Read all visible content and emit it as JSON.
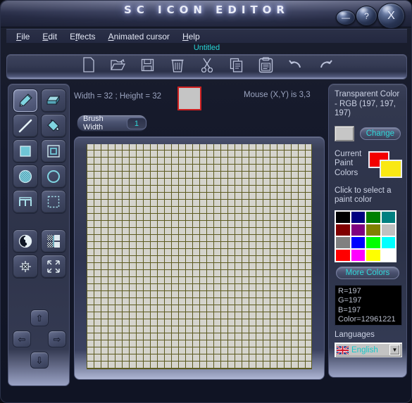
{
  "window": {
    "title": "SC ICON EDITOR",
    "controls": {
      "minimize": "—",
      "help": "?",
      "close": "X"
    }
  },
  "menubar": {
    "items": [
      {
        "label": "File",
        "accel": "F"
      },
      {
        "label": "Edit",
        "accel": "E"
      },
      {
        "label": "Effects",
        "accel": "f"
      },
      {
        "label": "Animated cursor",
        "accel": "A"
      },
      {
        "label": "Help",
        "accel": "H"
      }
    ]
  },
  "document": {
    "name": "Untitled"
  },
  "toolbar": {
    "buttons": [
      {
        "name": "new-file",
        "tooltip": "New"
      },
      {
        "name": "open-file",
        "tooltip": "Open"
      },
      {
        "name": "save-file",
        "tooltip": "Save"
      },
      {
        "name": "delete",
        "tooltip": "Delete"
      },
      {
        "name": "cut",
        "tooltip": "Cut"
      },
      {
        "name": "copy",
        "tooltip": "Copy"
      },
      {
        "name": "paste",
        "tooltip": "Paste"
      },
      {
        "name": "undo",
        "tooltip": "Undo"
      },
      {
        "name": "redo",
        "tooltip": "Redo"
      }
    ]
  },
  "tools": {
    "items": [
      {
        "name": "pencil",
        "selected": true
      },
      {
        "name": "eraser",
        "selected": false
      },
      {
        "name": "line",
        "selected": false
      },
      {
        "name": "paint-bucket",
        "selected": false
      },
      {
        "name": "filled-rectangle",
        "selected": false
      },
      {
        "name": "rectangle-outline",
        "selected": false
      },
      {
        "name": "filled-circle",
        "selected": false
      },
      {
        "name": "circle-outline",
        "selected": false
      },
      {
        "name": "text-tool",
        "selected": false
      },
      {
        "name": "select-region",
        "selected": false
      },
      {
        "name": "airbrush",
        "selected": false
      },
      {
        "name": "eyedropper",
        "selected": false
      },
      {
        "name": "invert-colors",
        "selected": false
      },
      {
        "name": "transparency",
        "selected": false
      },
      {
        "name": "shrink",
        "selected": false
      },
      {
        "name": "stretch",
        "selected": false
      }
    ],
    "arrows": {
      "up": "⇧",
      "left": "⇦",
      "right": "⇨",
      "down": "⇩"
    }
  },
  "canvas": {
    "dimensions_text": "Width = 32 ; Height = 32",
    "mouse_text": "Mouse (X,Y) is 3,3",
    "brush_width_label": "Brush Width",
    "brush_width_value": "1",
    "preview_color": "#c5c5c5",
    "preview_border": "#ce2020",
    "grid_cols": 32,
    "grid_rows": 32,
    "cell_color": "#d5d4cd",
    "grid_line_color": "#5c5a20"
  },
  "rightpanel": {
    "transparent_label": "Transparent Color - RGB (197, 197, 197)",
    "transparent_color": "#c6c6c6",
    "change_label": "Change",
    "paint_label": "Current Paint Colors",
    "paint_primary": "#f20000",
    "paint_secondary": "#f9e814",
    "click_label": "Click to select a paint color",
    "palette": [
      "#000000",
      "#000080",
      "#008000",
      "#008080",
      "#800000",
      "#800080",
      "#808000",
      "#c0c0c0",
      "#808080",
      "#0000ff",
      "#00ff00",
      "#00ffff",
      "#ff0000",
      "#ff00ff",
      "#ffff00",
      "#ffffff"
    ],
    "more_colors_label": "More Colors",
    "rgb_info": {
      "r": "R=197",
      "g": "G=197",
      "b": "B=197",
      "color": "Color=12961221"
    },
    "languages_label": "Languages",
    "selected_language": "English",
    "dropdown_arrow": "▼"
  }
}
